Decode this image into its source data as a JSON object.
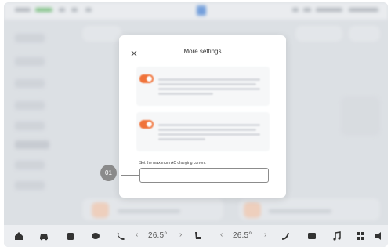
{
  "status_bar": {
    "left_items": [
      "",
      "",
      "",
      ""
    ],
    "right_items": [
      "",
      "",
      ""
    ]
  },
  "modal": {
    "title": "More settings",
    "options": [
      {
        "title": "",
        "enabled": true
      },
      {
        "title": "",
        "enabled": true
      }
    ],
    "max_ac_current": {
      "label": "Set the maximum AC charging current",
      "value": ""
    }
  },
  "callout": {
    "number": "01"
  },
  "dock": {
    "left_temp": "26.5°",
    "right_temp": "26.5°",
    "icons": [
      "home-icon",
      "car-icon",
      "media-player-icon",
      "chat-icon",
      "phone-icon",
      "seat-icon",
      "wiper-icon",
      "app-grid-icon",
      "music-icon",
      "grid-icon",
      "volume-icon"
    ]
  },
  "colors": {
    "accent": "#f0733a",
    "brand": "#3a7bd5"
  }
}
